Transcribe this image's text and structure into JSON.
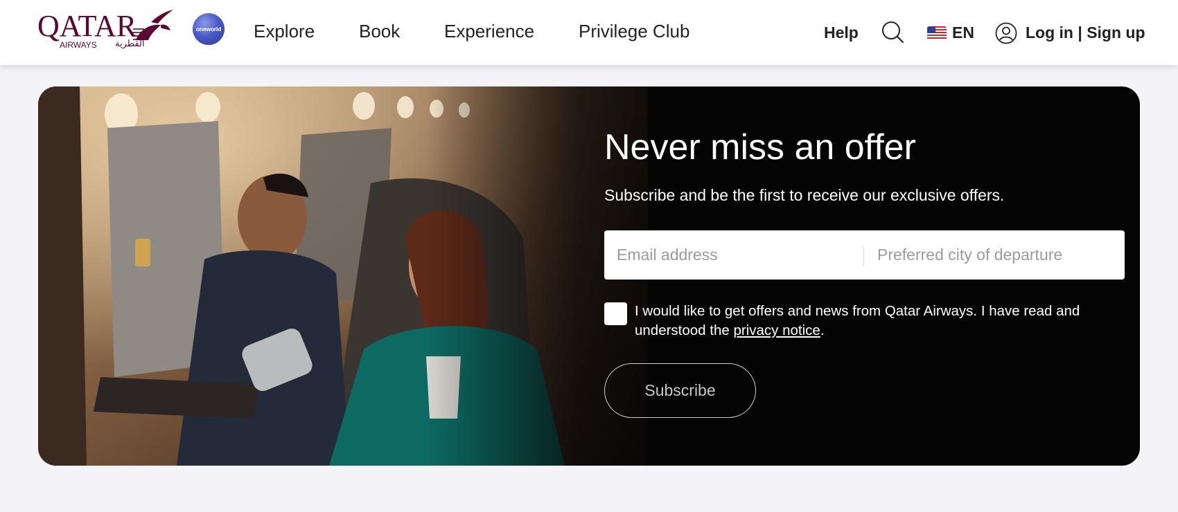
{
  "brand": {
    "logo_word": "QATAR",
    "logo_sub": "AIRWAYS",
    "logo_arabic": "القطرية",
    "oneworld_label": "oneworld",
    "brand_color": "#5c0632"
  },
  "nav": {
    "items": [
      {
        "label": "Explore"
      },
      {
        "label": "Book"
      },
      {
        "label": "Experience"
      },
      {
        "label": "Privilege Club"
      }
    ]
  },
  "utility": {
    "help": "Help",
    "search_icon": "search-icon",
    "language": "EN",
    "flag_icon": "us-flag-icon",
    "user_icon": "user-icon",
    "login": "Log in | Sign up"
  },
  "banner": {
    "title": "Never miss an offer",
    "subtitle": "Subscribe and be the first to receive our exclusive offers.",
    "email_placeholder": "Email address",
    "city_placeholder": "Preferred city of departure",
    "consent_text_1": "I would like to get offers and news from Qatar Airways. I have read and understood the ",
    "consent_link": "privacy notice",
    "consent_text_2": ".",
    "subscribe_label": "Subscribe"
  }
}
